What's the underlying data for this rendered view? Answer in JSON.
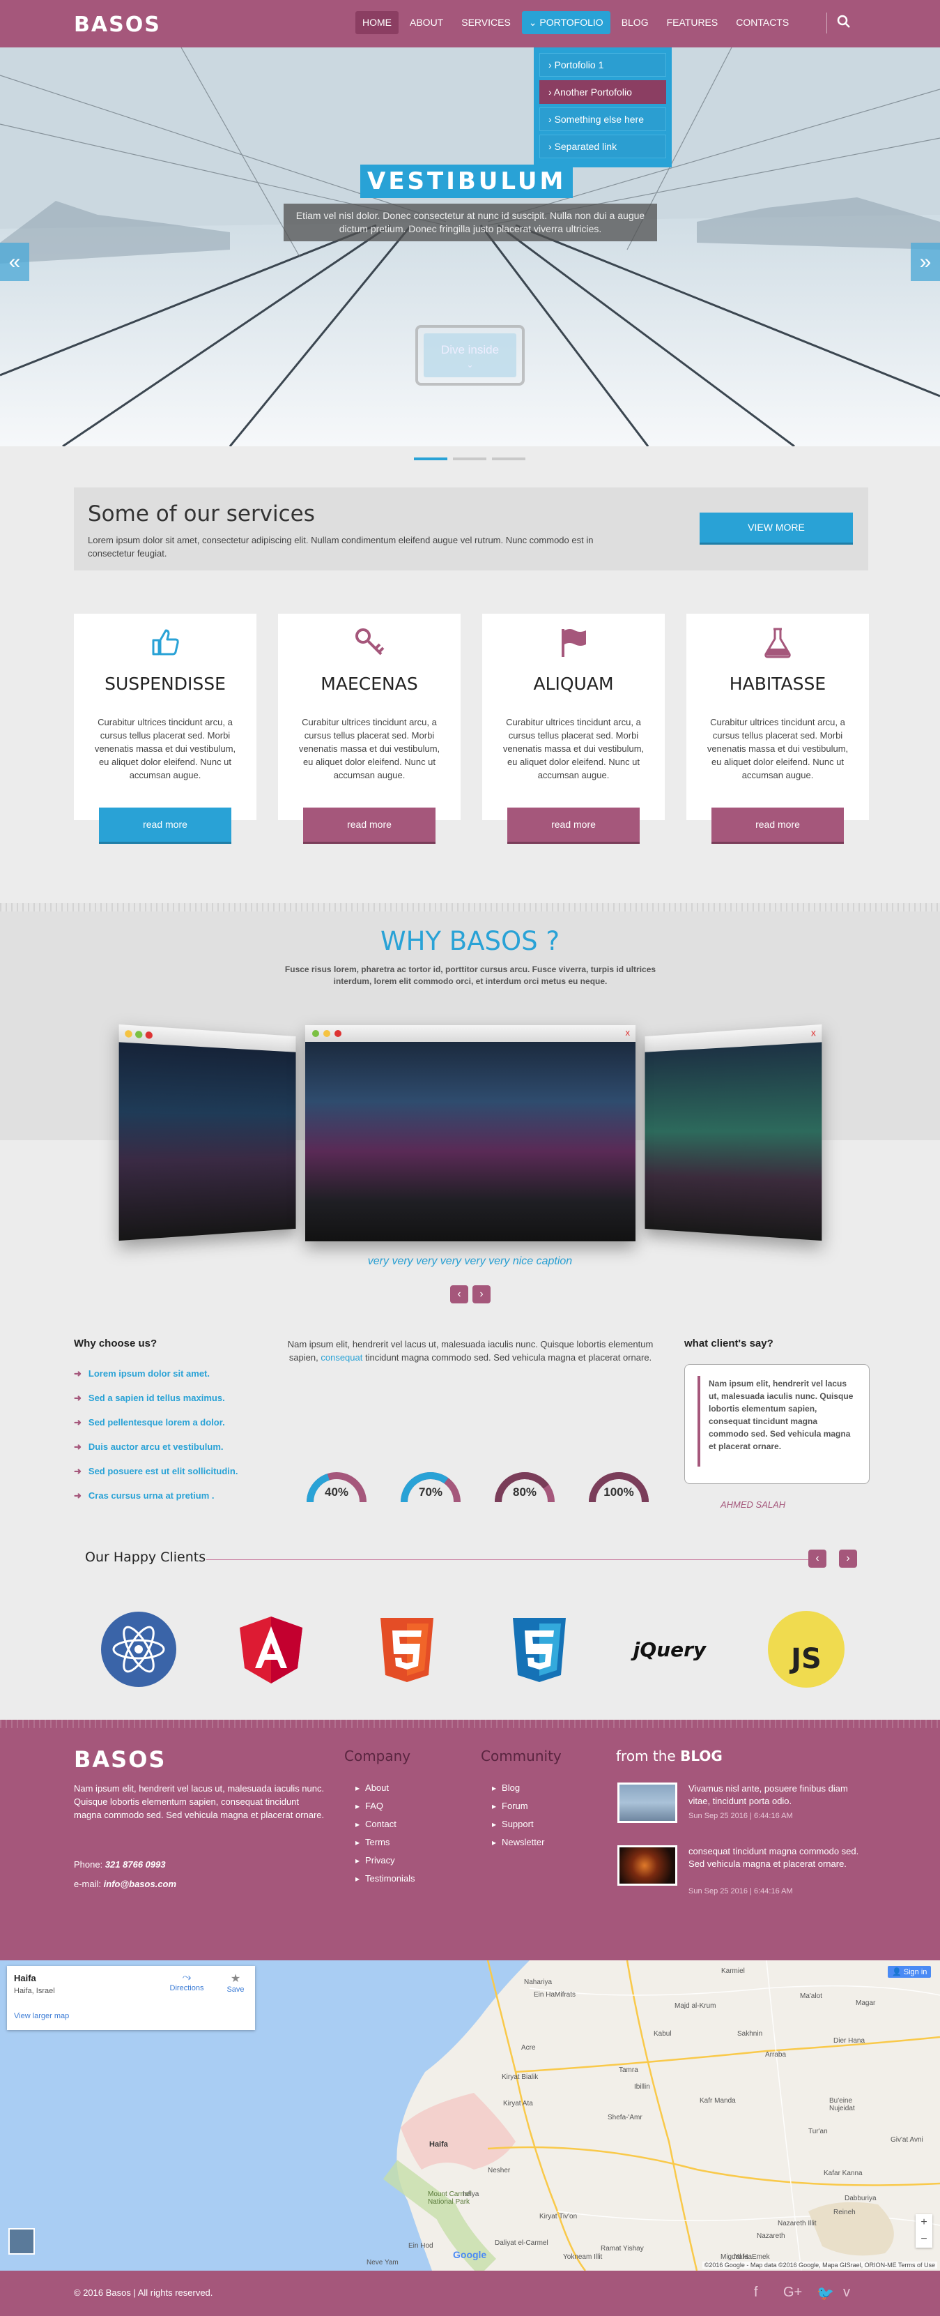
{
  "brand": {
    "logo": "BASOS"
  },
  "nav": {
    "items": [
      "HOME",
      "ABOUT",
      "SERVICES",
      "PORTOFOLIO",
      "BLOG",
      "FEATURES",
      "CONTACTS"
    ],
    "dropdown": [
      "Portofolio 1",
      "Another Portofolio",
      "Something else here",
      "Separated link"
    ]
  },
  "hero": {
    "title": "VESTIBULUM",
    "caption": "Etiam vel nisl dolor. Donec consectetur at nunc id suscipit. Nulla non dui a augue dictum pretium. Donec fringilla justo placerat viverra ultricies.",
    "button": "Dive inside"
  },
  "services": {
    "title": "Some of our services",
    "text": "Lorem ipsum dolor sit amet, consectetur adipiscing elit. Nullam condimentum eleifend augue vel rutrum. Nunc commodo est in consectetur feugiat.",
    "view_more": "VIEW MORE",
    "cards": [
      {
        "title": "SUSPENDISSE",
        "icon": "thumbs-up-icon",
        "text": "Curabitur ultrices tincidunt arcu, a cursus tellus placerat sed. Morbi venenatis massa et dui vestibulum, eu aliquet dolor eleifend. Nunc ut accumsan augue.",
        "button": "read more"
      },
      {
        "title": "MAECENAS",
        "icon": "key-icon",
        "text": "Curabitur ultrices tincidunt arcu, a cursus tellus placerat sed. Morbi venenatis massa et dui vestibulum, eu aliquet dolor eleifend. Nunc ut accumsan augue.",
        "button": "read more"
      },
      {
        "title": "ALIQUAM",
        "icon": "flag-icon",
        "text": "Curabitur ultrices tincidunt arcu, a cursus tellus placerat sed. Morbi venenatis massa et dui vestibulum, eu aliquet dolor eleifend. Nunc ut accumsan augue.",
        "button": "read more"
      },
      {
        "title": "HABITASSE",
        "icon": "flask-icon",
        "text": "Curabitur ultrices tincidunt arcu, a cursus tellus placerat sed. Morbi venenatis massa et dui vestibulum, eu aliquet dolor eleifend. Nunc ut accumsan augue.",
        "button": "read more"
      }
    ]
  },
  "why": {
    "title": "WHY BASOS ?",
    "text": "Fusce risus lorem, pharetra ac tortor id, porttitor cursus arcu. Fusce viverra, turpis id ultrices interdum, lorem elit commodo orci, et interdum orci metus eu neque.",
    "caption": "very very very very very very nice caption"
  },
  "choose": {
    "title": "Why choose us?",
    "items": [
      "Lorem ipsum dolor sit amet.",
      "Sed a sapien id tellus maximus.",
      "Sed pellentesque lorem a dolor.",
      "Duis auctor arcu et vestibulum.",
      "Sed posuere est ut elit sollicitudin.",
      "Cras cursus urna at pretium ."
    ]
  },
  "skills": {
    "text_before": "Nam ipsum elit, hendrerit vel lacus ut, malesuada iaculis nunc. Quisque lobortis elementum sapien,",
    "link": "consequat",
    "text_after": "tincidunt magna commodo sed. Sed vehicula magna et placerat ornare.",
    "values": [
      {
        "label": "40%",
        "value": 0.4,
        "color": "#29a2d6"
      },
      {
        "label": "70%",
        "value": 0.7,
        "color": "#29a2d6"
      },
      {
        "label": "80%",
        "value": 0.8,
        "color": "#a5577b"
      },
      {
        "label": "100%",
        "value": 1.0,
        "color": "#a5577b"
      }
    ]
  },
  "testimonial": {
    "title": "what client's say?",
    "quote": "Nam ipsum elit, hendrerit vel lacus ut, malesuada iaculis nunc. Quisque lobortis elementum sapien, consequat tincidunt magna commodo sed. Sed vehicula magna et placerat ornare.",
    "name": "AHMED SALAH"
  },
  "clients": {
    "title": "Our Happy Clients",
    "logos": [
      "react-logo",
      "angular-logo",
      "html5-logo",
      "css3-logo",
      "jquery-logo",
      "js-logo"
    ],
    "jquery_text": "jQuery",
    "js_text": "JS"
  },
  "footer": {
    "logo": "BASOS",
    "text": "Nam ipsum elit, hendrerit vel lacus ut, malesuada iaculis nunc. Quisque lobortis elementum sapien, consequat tincidunt magna commodo sed. Sed vehicula magna et placerat ornare.",
    "phone_label": "Phone:",
    "phone": "321 8766 0993",
    "email_label": "e-mail:",
    "email": "info@basos.com",
    "company_title": "Company",
    "company_links": [
      "About",
      "FAQ",
      "Contact",
      "Terms",
      "Privacy",
      "Testimonials"
    ],
    "community_title": "Community",
    "community_links": [
      "Blog",
      "Forum",
      "Support",
      "Newsletter"
    ],
    "blog_title_pre": "from the",
    "blog_title_bold": "BLOG",
    "blog_posts": [
      {
        "text": "Vivamus nisl ante, posuere finibus diam vitae, tincidunt porta odio.",
        "date": "Sun Sep 25 2016 | 6:44:16 AM"
      },
      {
        "text": "consequat tincidunt magna commodo sed. Sed vehicula magna et placerat ornare.",
        "date": "Sun Sep 25 2016 | 6:44:16 AM"
      }
    ]
  },
  "map": {
    "place": "Haifa",
    "region": "Haifa, Israel",
    "directions": "Directions",
    "save": "Save",
    "larger": "View larger map",
    "signin": "Sign in",
    "labels": [
      "Haifa",
      "Karmiel",
      "Nahariya",
      "Acre",
      "Kiryat Ata",
      "Kiryat Bialik",
      "Shefa-'Amr",
      "Tamra",
      "Sakhnin",
      "Arraba",
      "Kafr Manda",
      "Nazareth",
      "Nazareth Illit",
      "Kiryat Tiv'on",
      "Yokneam Illit",
      "Daliyat el-Carmel",
      "Nesher",
      "Mount Carmel National Park",
      "Migdal HaEmek",
      "Ibillin",
      "Kabul",
      "Majd al-Krum",
      "Tur'an",
      "Kafar Kanna",
      "Dabburiya",
      "Reineh",
      "Yafa",
      "Isfiya",
      "Ramat Yishay",
      "Ein HaMifrats",
      "Ein Hod",
      "Neve Yam",
      "Ma'alot",
      "Magar",
      "Dier Hana",
      "Bu'eine Nujeidat",
      "Giv'at Avni"
    ],
    "attribution": "©2016 Google - Map data ©2016 Google, Mapa GISrael, ORION-ME   Terms of Use",
    "google": "Google"
  },
  "bottom": {
    "copyright": "© 2016 Basos | All rights reserved."
  }
}
